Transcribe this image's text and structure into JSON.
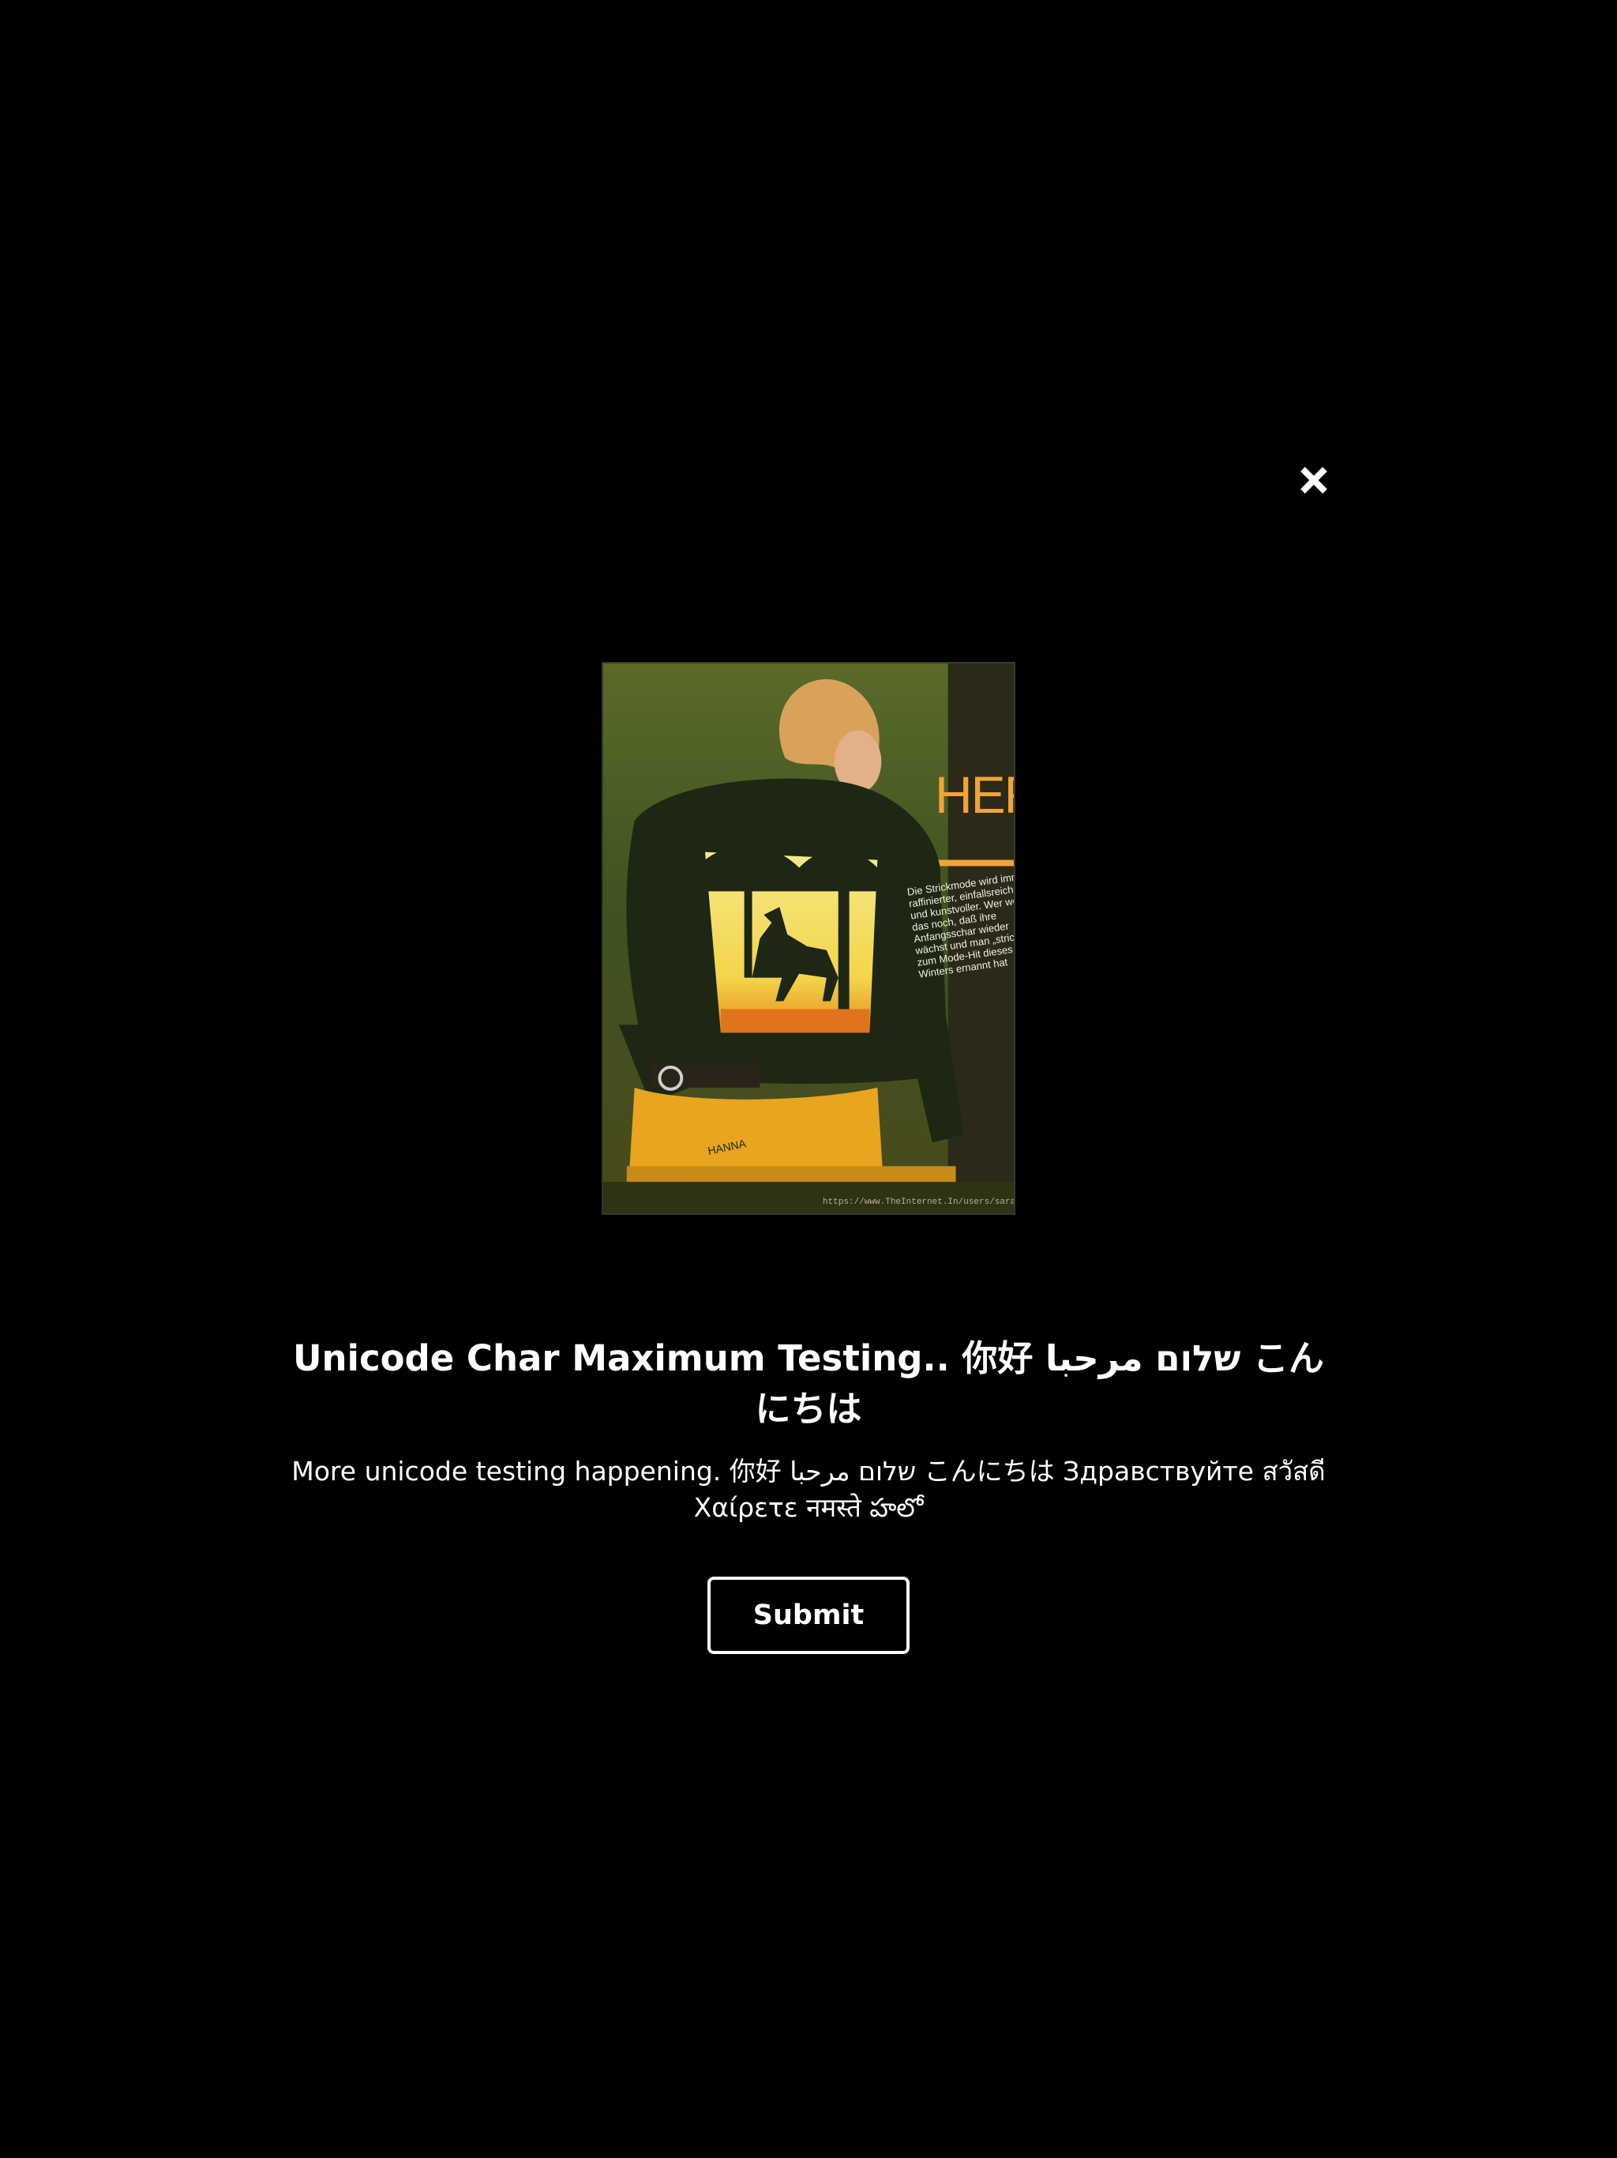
{
  "dialog": {
    "close": {
      "icon": "close-icon"
    },
    "image": {
      "cover_title": "HER",
      "cover_text": "Die Strickmode wird immer raffinierter, einfallsreicher und kunstvoller. Wer weiß das noch, daß ihre Anfangsschar wieder wächst und man „strickt“ zum Mode-Hit dieses Winters ernannt hat",
      "model_name": "HANNA",
      "url": "https://www.TheInternet.In/users/sarasd/"
    },
    "title": "Unicode Char Maximum Testing.. 你好 שלום مرحبا こんにちは",
    "description": "More unicode testing happening. 你好 שלום مرحبا こんにちは Здравствуйте สวัสดี Χαίρετε नमस्ते హలో",
    "submit_label": "Submit"
  },
  "colors": {
    "background": "#000000",
    "text": "#ffffff",
    "button_border": "#ffffff",
    "cover_accent": "#f2a33a"
  }
}
